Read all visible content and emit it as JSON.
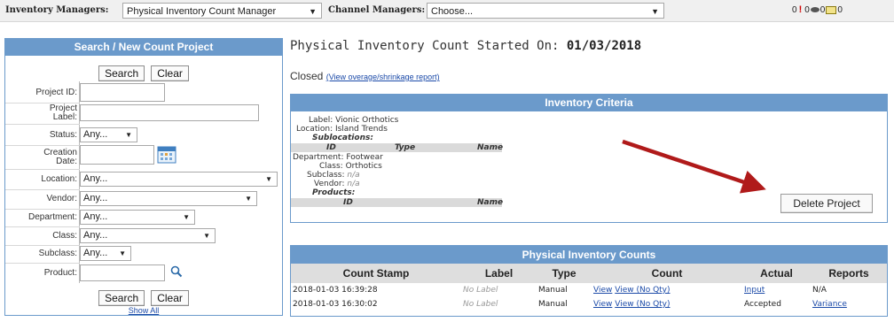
{
  "topbar": {
    "inventory_label": "Inventory Managers:",
    "inventory_value": "Physical Inventory Count Manager",
    "channel_label": "Channel Managers:",
    "channel_value": "Choose...",
    "alerts_count": "0",
    "messages_count": "0",
    "mail_count": "0",
    "mail_count2": "0"
  },
  "search_panel": {
    "title": "Search / New Count Project",
    "search_button": "Search",
    "clear_button": "Clear",
    "fields": {
      "project_id": "Project ID:",
      "project_label_1": "Project",
      "project_label_2": "Label:",
      "status": "Status:",
      "status_value": "Any...",
      "creation_1": "Creation",
      "creation_2": "Date:",
      "location": "Location:",
      "location_value": "Any...",
      "vendor": "Vendor:",
      "vendor_value": "Any...",
      "department": "Department:",
      "department_value": "Any...",
      "class": "Class:",
      "class_value": "Any...",
      "subclass": "Subclass:",
      "subclass_value": "Any...",
      "product": "Product:"
    },
    "show_all": "Show All"
  },
  "main": {
    "title_prefix": "Physical Inventory Count Started On:",
    "title_date": "01/03/2018",
    "status": "Closed",
    "overage_link": "(View overage/shrinkage report)"
  },
  "criteria": {
    "title": "Inventory Criteria",
    "label": "Label: Vionic Orthotics",
    "location": "Location: Island Trends",
    "sublocations": "Sublocations:",
    "sub_cols": [
      "ID",
      "Type",
      "Name"
    ],
    "department": "Department: Footwear",
    "class": "Class: Orthotics",
    "subclass_key": "Subclass:",
    "subclass_val": "n/a",
    "vendor_key": "Vendor:",
    "vendor_val": "n/a",
    "products": "Products:",
    "prod_cols": [
      "ID",
      "Name"
    ],
    "delete_button": "Delete Project"
  },
  "counts": {
    "title": "Physical Inventory Counts",
    "columns": [
      "Count Stamp",
      "Label",
      "Type",
      "Count",
      "Actual",
      "Reports"
    ],
    "rows": [
      {
        "stamp": "2018-01-03 16:39:28",
        "label": "No Label",
        "type": "Manual",
        "view": "View",
        "view_noqty": "View (No Qty)",
        "actual": "Input",
        "reports": "N/A"
      },
      {
        "stamp": "2018-01-03 16:30:02",
        "label": "No Label",
        "type": "Manual",
        "view": "View",
        "view_noqty": "View (No Qty)",
        "actual": "Accepted",
        "reports": "Variance"
      }
    ]
  }
}
